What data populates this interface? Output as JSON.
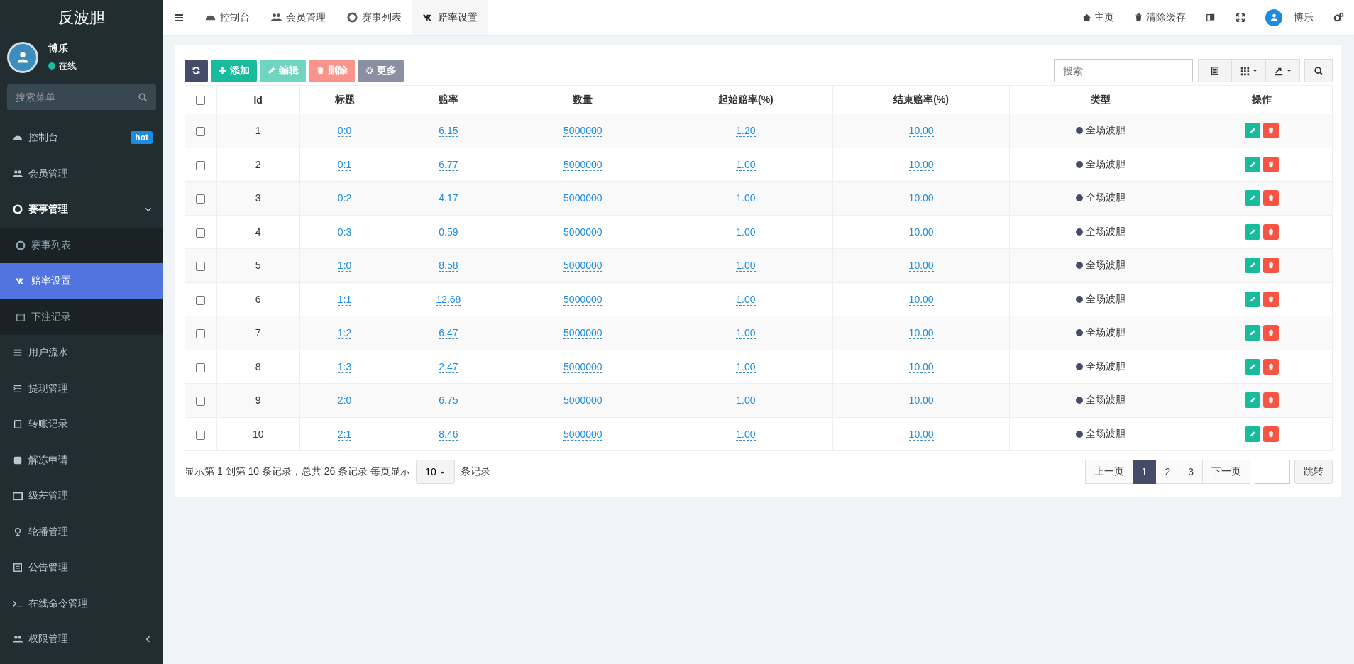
{
  "sidebar": {
    "logo": "反波胆",
    "user": {
      "name": "博乐",
      "status": "在线"
    },
    "search": {
      "placeholder": "搜索菜单"
    },
    "items": [
      {
        "label": "控制台",
        "badge": "hot",
        "selected": false
      },
      {
        "label": "会员管理",
        "selected": false
      },
      {
        "label": "赛事管理",
        "selected": false,
        "expanded": true,
        "children": [
          {
            "label": "赛事列表",
            "selected": false
          },
          {
            "label": "赔率设置",
            "selected": true
          },
          {
            "label": "下注记录",
            "selected": false
          }
        ]
      },
      {
        "label": "用户流水",
        "selected": false
      },
      {
        "label": "提现管理",
        "selected": false
      },
      {
        "label": "转账记录",
        "selected": false
      },
      {
        "label": "解冻申请",
        "selected": false
      },
      {
        "label": "级差管理",
        "selected": false
      },
      {
        "label": "轮播管理",
        "selected": false
      },
      {
        "label": "公告管理",
        "selected": false
      },
      {
        "label": "在线命令管理",
        "selected": false
      },
      {
        "label": "权限管理",
        "selected": false,
        "expanded": false
      }
    ]
  },
  "topbar": {
    "tabs": [
      {
        "label": "控制台",
        "selected": false
      },
      {
        "label": "会员管理",
        "selected": false
      },
      {
        "label": "赛事列表",
        "selected": false
      },
      {
        "label": "赔率设置",
        "selected": true
      }
    ],
    "links": [
      {
        "label": "主页"
      },
      {
        "label": "清除缓存"
      }
    ],
    "user": "博乐"
  },
  "toolbar": {
    "buttons": [
      {
        "kind": "refresh",
        "disabled": false
      },
      {
        "kind": "add",
        "label": "添加",
        "disabled": false
      },
      {
        "kind": "edit",
        "label": "编辑",
        "disabled": true
      },
      {
        "kind": "delete",
        "label": "删除",
        "disabled": true
      },
      {
        "kind": "more",
        "label": "更多",
        "disabled": true
      }
    ],
    "search": {
      "placeholder": "搜索"
    }
  },
  "table": {
    "select_all_checked": false,
    "columns": [
      "Id",
      "标题",
      "赔率",
      "数量",
      "起始赔率(%)",
      "结束赔率(%)",
      "类型",
      "操作"
    ],
    "rows": [
      {
        "checked": false,
        "id": "1",
        "title": "0:0",
        "odds": "6.15",
        "quantity": "5000000",
        "start": "1.20",
        "end": "10.00",
        "type": "全场波胆",
        "color": "#444c69"
      },
      {
        "checked": false,
        "id": "2",
        "title": "0:1",
        "odds": "6.77",
        "quantity": "5000000",
        "start": "1.00",
        "end": "10.00",
        "type": "全场波胆",
        "color": "#444c69"
      },
      {
        "checked": false,
        "id": "3",
        "title": "0:2",
        "odds": "4.17",
        "quantity": "5000000",
        "start": "1.00",
        "end": "10.00",
        "type": "全场波胆",
        "color": "#444c69"
      },
      {
        "checked": false,
        "id": "4",
        "title": "0:3",
        "odds": "0.59",
        "quantity": "5000000",
        "start": "1.00",
        "end": "10.00",
        "type": "全场波胆",
        "color": "#444c69"
      },
      {
        "checked": false,
        "id": "5",
        "title": "1:0",
        "odds": "8.58",
        "quantity": "5000000",
        "start": "1.00",
        "end": "10.00",
        "type": "全场波胆",
        "color": "#444c69"
      },
      {
        "checked": false,
        "id": "6",
        "title": "1:1",
        "odds": "12.68",
        "quantity": "5000000",
        "start": "1.00",
        "end": "10.00",
        "type": "全场波胆",
        "color": "#444c69"
      },
      {
        "checked": false,
        "id": "7",
        "title": "1:2",
        "odds": "6.47",
        "quantity": "5000000",
        "start": "1.00",
        "end": "10.00",
        "type": "全场波胆",
        "color": "#444c69"
      },
      {
        "checked": false,
        "id": "8",
        "title": "1:3",
        "odds": "2.47",
        "quantity": "5000000",
        "start": "1.00",
        "end": "10.00",
        "type": "全场波胆",
        "color": "#444c69"
      },
      {
        "checked": false,
        "id": "9",
        "title": "2:0",
        "odds": "6.75",
        "quantity": "5000000",
        "start": "1.00",
        "end": "10.00",
        "type": "全场波胆",
        "color": "#444c69"
      },
      {
        "checked": false,
        "id": "10",
        "title": "2:1",
        "odds": "8.46",
        "quantity": "5000000",
        "start": "1.00",
        "end": "10.00",
        "type": "全场波胆",
        "color": "#444c69"
      }
    ]
  },
  "footer": {
    "info": "显示第 1 到第 10 条记录，总共 26 条记录 每页显示",
    "page_size": "10",
    "suffix": "条记录",
    "pages": [
      {
        "label": "上一页",
        "selected": false
      },
      {
        "label": "1",
        "selected": true
      },
      {
        "label": "2",
        "selected": false
      },
      {
        "label": "3",
        "selected": false
      },
      {
        "label": "下一页",
        "selected": false
      }
    ],
    "jump": "跳转"
  }
}
